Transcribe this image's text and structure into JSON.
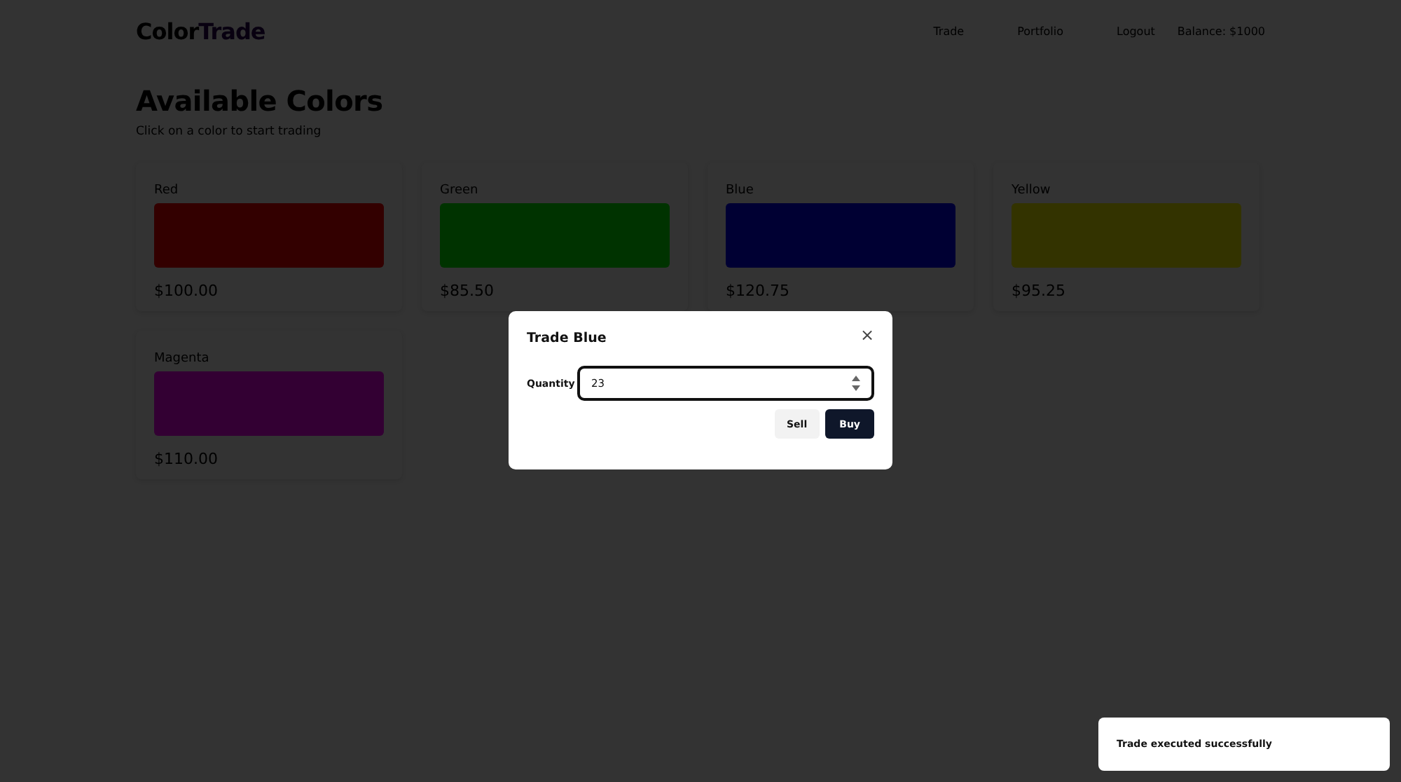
{
  "header": {
    "logo_first": "Color",
    "logo_second": "Trade",
    "nav": [
      "Trade",
      "Portfolio",
      "Logout"
    ],
    "balance": "Balance: $1000"
  },
  "page": {
    "title": "Available Colors",
    "subtitle": "Click on a color to start trading"
  },
  "colors": [
    {
      "name": "Red",
      "color": "#330000",
      "price": "$100.00"
    },
    {
      "name": "Green",
      "color": "#003300",
      "price": "$85.50"
    },
    {
      "name": "Blue",
      "color": "#000033",
      "price": "$120.75"
    },
    {
      "name": "Yellow",
      "color": "#333300",
      "price": "$95.25"
    },
    {
      "name": "Magenta",
      "color": "#330033",
      "price": "$110.00"
    }
  ],
  "dialog": {
    "title": "Trade Blue",
    "close": "×",
    "quantity_label": "Quantity",
    "quantity_value": "23",
    "buttons": [
      "Sell",
      "Buy"
    ]
  },
  "toast": {
    "message": "Trade executed successfully"
  }
}
